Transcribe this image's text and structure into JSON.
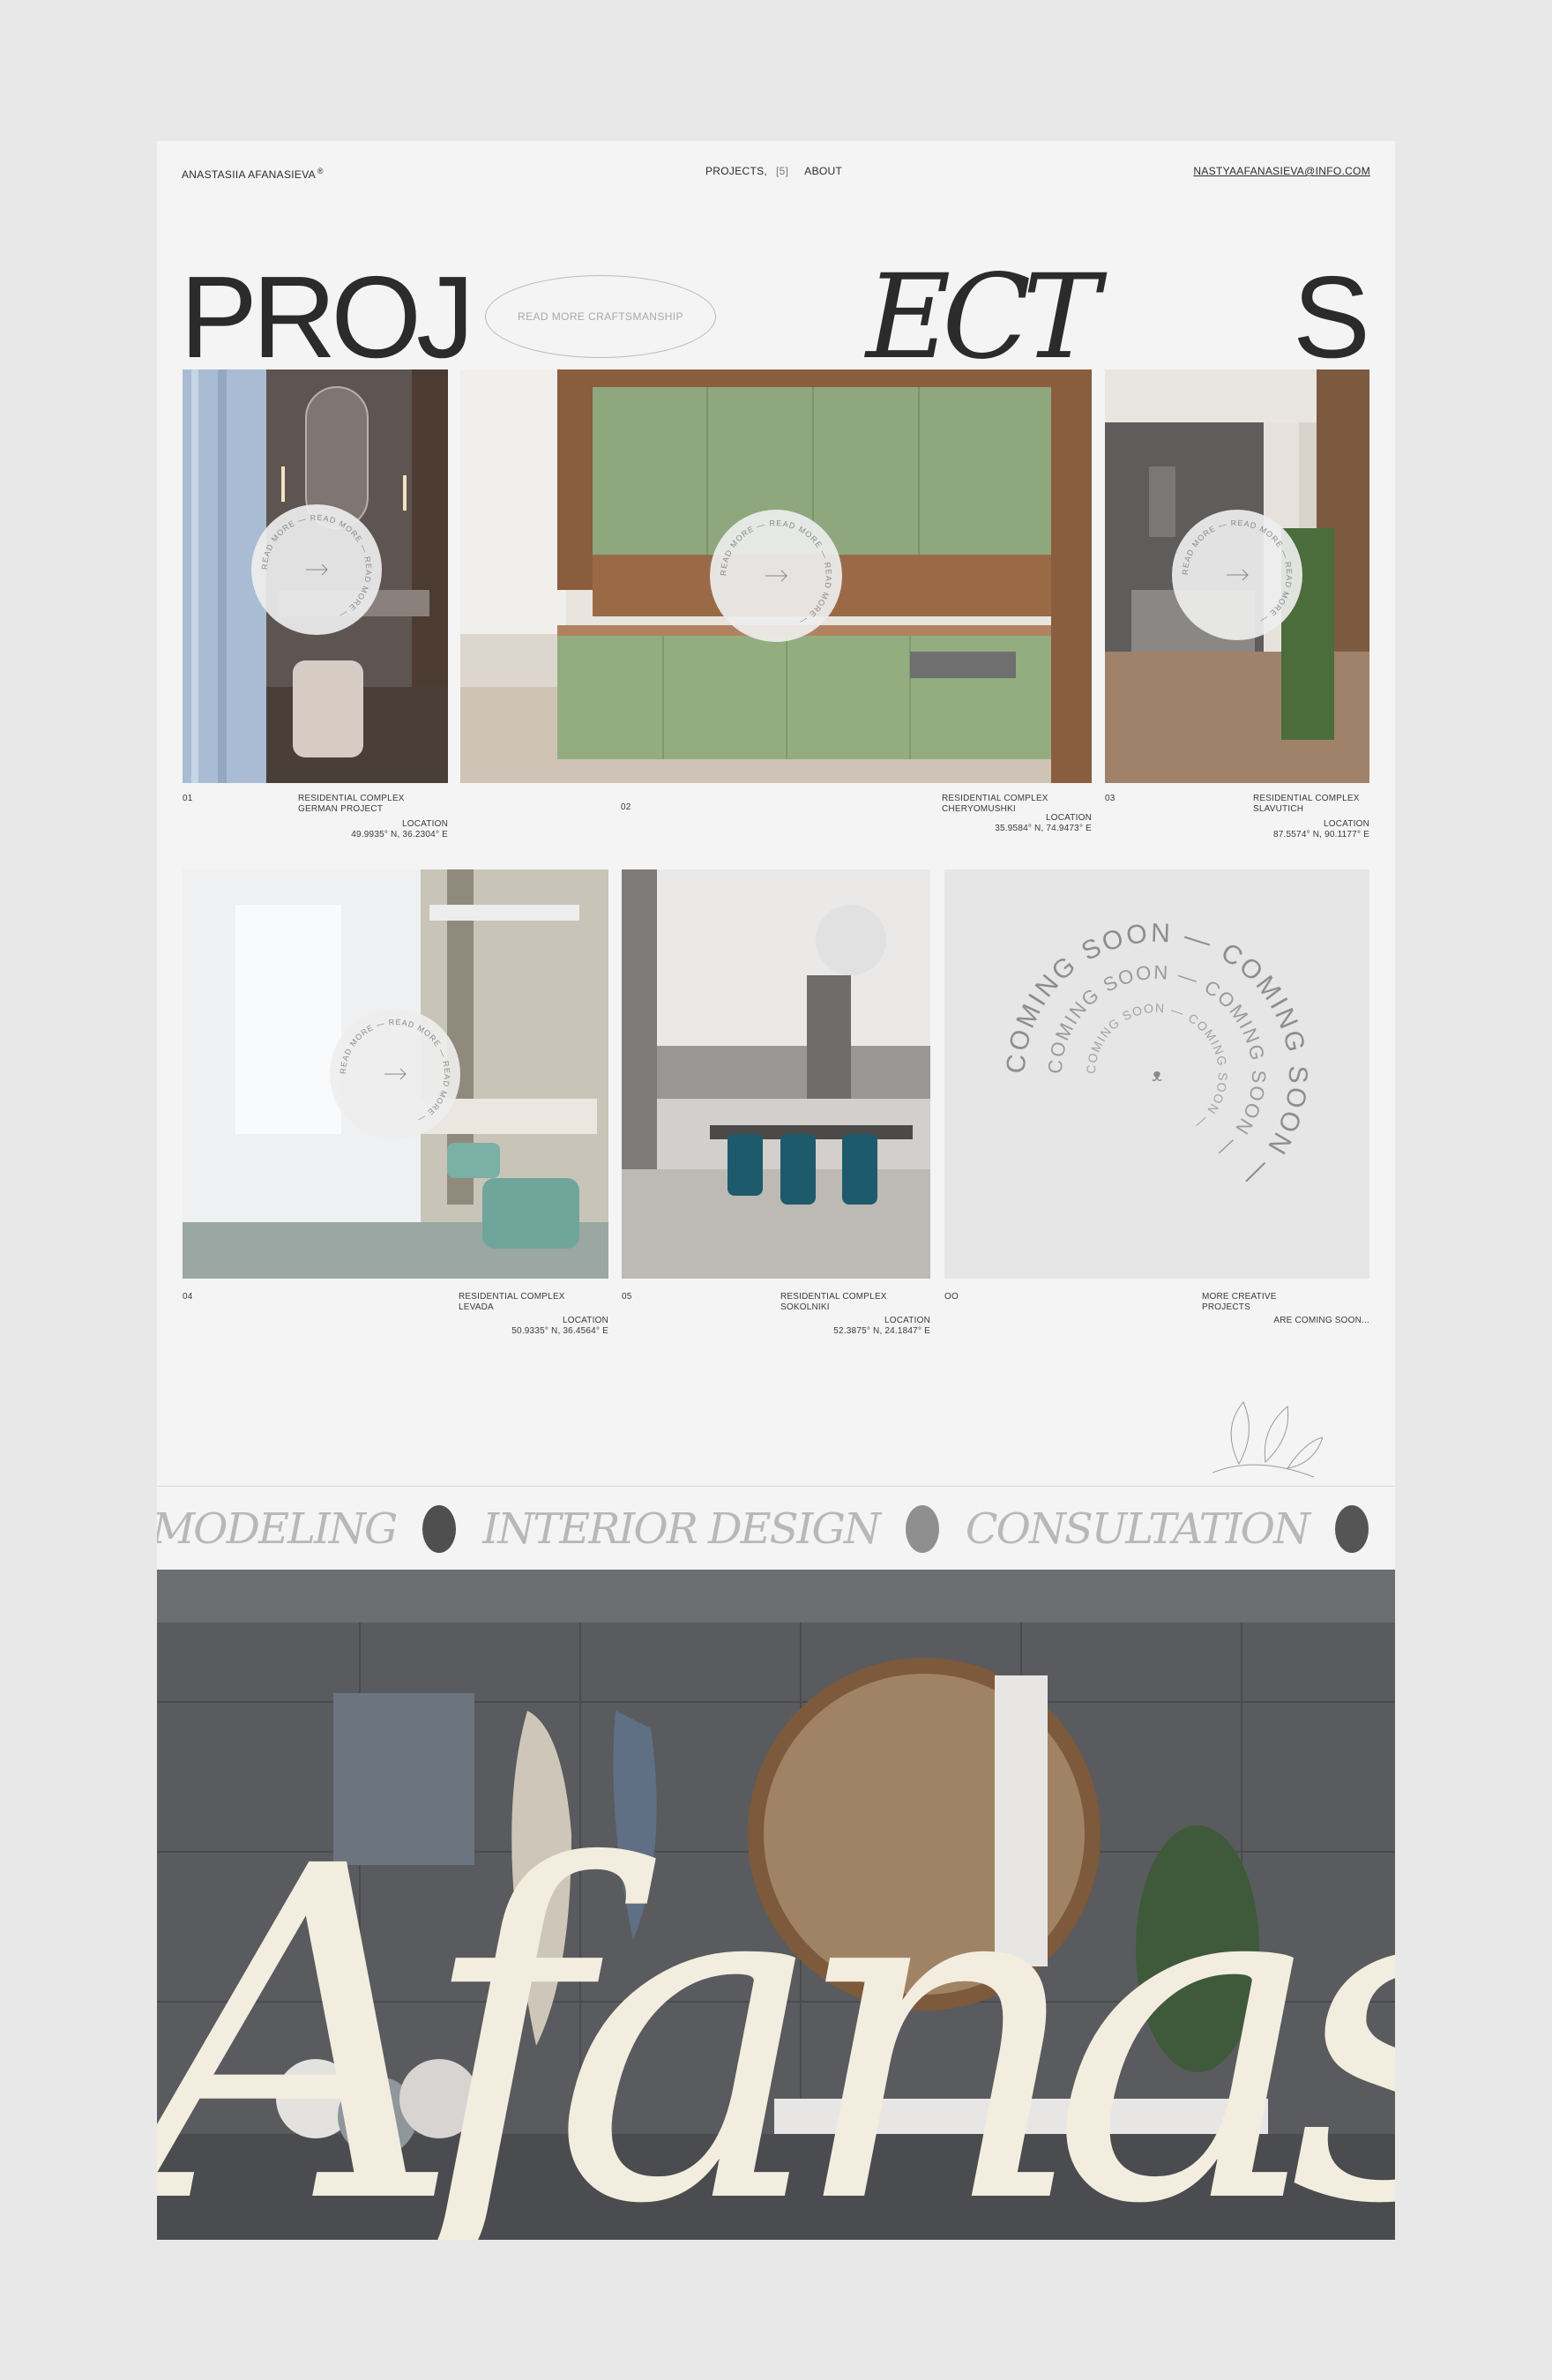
{
  "header": {
    "brand": "ANASTASIIA AFANASIEVA",
    "brand_mark": "®",
    "nav_projects": "PROJECTS,",
    "nav_count": "[5]",
    "nav_about": "ABOUT",
    "email": "NASTYAAFANASIEVA@INFO.COM"
  },
  "hero": {
    "word_left": "PROJ",
    "word_mid": "ECT",
    "word_right": "S",
    "oval_label": "READ MORE CRAFTSMANSHIP"
  },
  "badge_text": "READ MORE — READ MORE — READ MORE — ",
  "projects": [
    {
      "num": "01",
      "title1": "RESIDENTIAL COMPLEX",
      "title2": "GERMAN PROJECT",
      "loc_label": "LOCATION",
      "coords": "49.9935° N, 36.2304° E"
    },
    {
      "num": "02",
      "title1": "RESIDENTIAL COMPLEX",
      "title2": "CHERYOMUSHKI",
      "loc_label": "LOCATION",
      "coords": "35.9584° N, 74.9473° E"
    },
    {
      "num": "03",
      "title1": "RESIDENTIAL COMPLEX",
      "title2": "SLAVUTICH",
      "loc_label": "LOCATION",
      "coords": "87.5574° N, 90.1177° E"
    },
    {
      "num": "04",
      "title1": "RESIDENTIAL COMPLEX",
      "title2": "LEVADA",
      "loc_label": "LOCATION",
      "coords": "50.9335° N, 36.4564° E"
    },
    {
      "num": "05",
      "title1": "RESIDENTIAL COMPLEX",
      "title2": "SOKOLNIKI",
      "loc_label": "LOCATION",
      "coords": "52.3875° N, 24.1847° E"
    }
  ],
  "coming": {
    "num": "OO",
    "title1": "MORE CREATIVE",
    "title2": "PROJECTS",
    "sub": "ARE COMING SOON...",
    "ring_text": "COMING SOON — COMING SOON — ",
    "center_mark": "ᴥ"
  },
  "marquee": {
    "w1": "MODELING",
    "w2": "INTERIOR DESIGN",
    "w3": "CONSULTATION"
  },
  "footer_hero": {
    "script_word": "Afanasi"
  },
  "colors": {
    "page_bg": "#f4f4f4",
    "outer_bg": "#e8e8e8",
    "ink": "#2b2b2b",
    "sage": "#8fa77c",
    "teal": "#1d5a6b",
    "cream_script": "#f3eddf"
  }
}
